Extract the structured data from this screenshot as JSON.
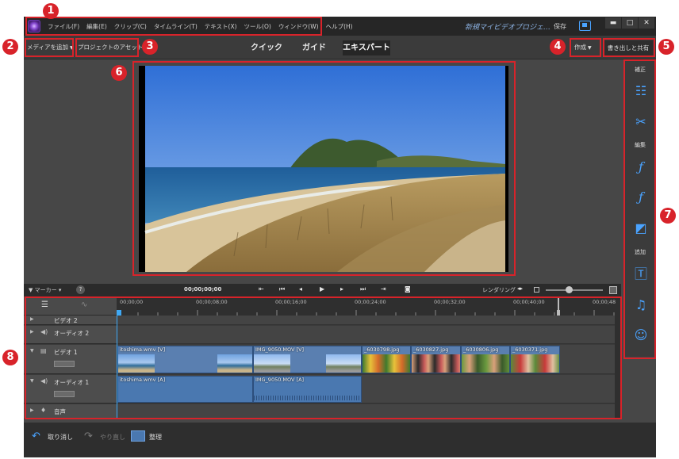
{
  "menubar": {
    "items": [
      "ファイル(F)",
      "編集(E)",
      "クリップ(C)",
      "タイムライン(T)",
      "テキスト(X)",
      "ツール(O)",
      "ウィンドウ(W)",
      "ヘルプ(H)"
    ],
    "project_name": "新規マイビデオプロジェ…",
    "save_label": "保存",
    "minimize": "▬",
    "maximize": "□",
    "close": "✕"
  },
  "toolbar": {
    "add_media": "メディアを追加",
    "project_assets": "プロジェクトのアセット",
    "tabs": [
      "クイック",
      "ガイド",
      "エキスパート"
    ],
    "create": "作成",
    "export_share": "書き出しと共有"
  },
  "transport": {
    "marker": "マーカー",
    "help": "?",
    "timecode": "00;00;00;00",
    "render": "レンダリング"
  },
  "timeline": {
    "ruler": [
      "00;00;00",
      "00;00;08;00",
      "00;00;16;00",
      "00;00;24;00",
      "00;00;32;00",
      "00;00;40;00",
      "00;00;48"
    ],
    "tracks": {
      "video2": "ビデオ 2",
      "audio2": "オーディオ 2",
      "video1": "ビデオ 1",
      "audio1": "オーディオ 1",
      "narration": "音声"
    },
    "clips": {
      "v1": "itoshima.wmv [V]",
      "v2": "IMG_9050.MOV [V]",
      "p1": "_6030798.jpg",
      "p2": "_6030827.jpg",
      "p3": "_6030806.jpg",
      "p4": "_6030371.jpg",
      "a1": "itoshima.wmv [A]",
      "a2": "IMG_9050.MOV [A]"
    }
  },
  "statusbar": {
    "undo": "取り消し",
    "redo": "やり直し",
    "organize": "整理"
  },
  "right_panel": {
    "adjust": "補正",
    "edit": "編集",
    "add": "追加"
  },
  "callouts": [
    "1",
    "2",
    "3",
    "4",
    "5",
    "6",
    "7",
    "8"
  ],
  "colors": {
    "callout": "#d8232a",
    "accent": "#4aa3ff",
    "clip": "#5a7fb0"
  }
}
